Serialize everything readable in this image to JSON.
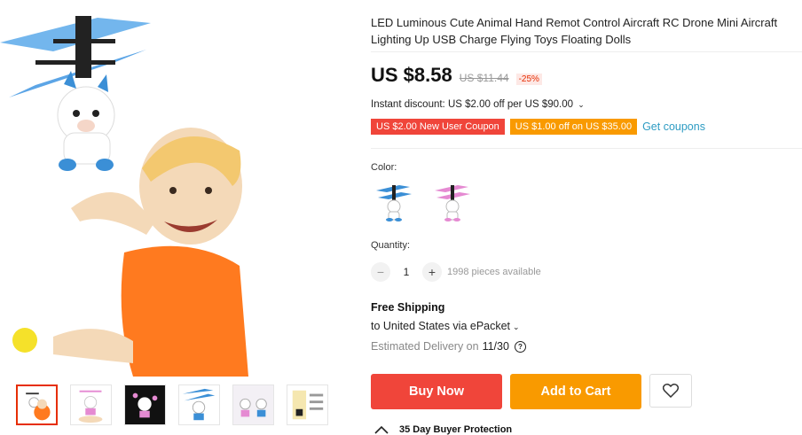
{
  "product": {
    "title": "LED Luminous Cute Animal Hand Remot Control Aircraft RC Drone Mini Aircraft Lighting Up USB Charge Flying Toys Floating Dolls"
  },
  "gallery": {
    "thumbnail_count": 6,
    "selected_index": 0
  },
  "pricing": {
    "price": "US $8.58",
    "original_price": "US $11.44",
    "discount_badge": "-25%",
    "instant_discount": "Instant discount: US $2.00 off per US $90.00",
    "coupon_new_user": "US $2.00 New User Coupon",
    "coupon_store": "US $1.00 off on US $35.00",
    "get_coupons_label": "Get coupons"
  },
  "colors": {
    "label": "Color:",
    "options": [
      {
        "name": "blue-unicorn",
        "accent": "#3b8fd6"
      },
      {
        "name": "pink-unicorn",
        "accent": "#e58ad2"
      }
    ]
  },
  "quantity": {
    "label": "Quantity:",
    "minus": "−",
    "value": "1",
    "plus": "+",
    "available": "1998 pieces available"
  },
  "shipping": {
    "title": "Free Shipping",
    "destination": "to United States via ePacket",
    "caret": "⌄",
    "delivery_label": "Estimated Delivery on",
    "delivery_date": "11/30",
    "help_icon": "?"
  },
  "actions": {
    "buy_now": "Buy Now",
    "add_to_cart": "Add to Cart",
    "wishlist_icon": "heart-icon"
  },
  "protection": {
    "label": "35 Day Buyer Protection"
  },
  "theme": {
    "red": "#f0453a",
    "orange": "#f99a00",
    "link": "#2e9cc3"
  }
}
